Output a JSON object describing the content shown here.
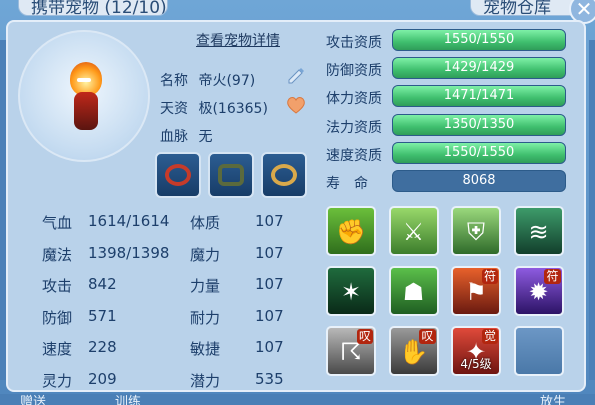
{
  "header": {
    "left_tab_text": "携带宠物 (12/10)",
    "right_tab_text": "宠物仓库"
  },
  "pet": {
    "detail_link": "查看宠物详情",
    "name_label": "名称",
    "name_value": "帝火(97)",
    "talent_label": "天资",
    "talent_value": "极(16365)",
    "bloodline_label": "血脉",
    "bloodline_value": "无"
  },
  "stats": [
    {
      "label": "气血",
      "value": "1614/1614"
    },
    {
      "label": "魔法",
      "value": "1398/1398"
    },
    {
      "label": "攻击",
      "value": "842"
    },
    {
      "label": "防御",
      "value": "571"
    },
    {
      "label": "速度",
      "value": "228"
    },
    {
      "label": "灵力",
      "value": "209"
    }
  ],
  "attributes": [
    {
      "label": "体质",
      "value": "107"
    },
    {
      "label": "魔力",
      "value": "107"
    },
    {
      "label": "力量",
      "value": "107"
    },
    {
      "label": "耐力",
      "value": "107"
    },
    {
      "label": "敏捷",
      "value": "107"
    },
    {
      "label": "潜力",
      "value": "535"
    }
  ],
  "aptitudes": [
    {
      "label": "攻击资质",
      "text": "1550/1550",
      "fill": 1.0
    },
    {
      "label": "防御资质",
      "text": "1429/1429",
      "fill": 1.0
    },
    {
      "label": "体力资质",
      "text": "1471/1471",
      "fill": 1.0
    },
    {
      "label": "法力资质",
      "text": "1350/1350",
      "fill": 1.0
    },
    {
      "label": "速度资质",
      "text": "1550/1550",
      "fill": 1.0
    }
  ],
  "life": {
    "label": "寿　命",
    "value": "8068"
  },
  "skills": [
    {
      "icon": "strength-icon",
      "tag": "",
      "level": ""
    },
    {
      "icon": "sword-icon",
      "tag": "",
      "level": ""
    },
    {
      "icon": "defense-icon",
      "tag": "",
      "level": ""
    },
    {
      "icon": "wind-icon",
      "tag": "",
      "level": ""
    },
    {
      "icon": "ice-flame-icon",
      "tag": "",
      "level": ""
    },
    {
      "icon": "giant-icon",
      "tag": "",
      "level": ""
    },
    {
      "icon": "warrior-icon",
      "tag": "符",
      "level": ""
    },
    {
      "icon": "burst-icon",
      "tag": "符",
      "level": ""
    },
    {
      "icon": "claw-icon",
      "tag": "叹",
      "level": ""
    },
    {
      "icon": "paw-icon",
      "tag": "叹",
      "level": ""
    },
    {
      "icon": "awaken-icon",
      "tag": "觉",
      "level": "4/5级"
    },
    {
      "icon": "empty-slot-icon",
      "tag": "",
      "level": ""
    }
  ],
  "footer": {
    "left": "赠送",
    "middle": "训练",
    "right": "放生"
  }
}
